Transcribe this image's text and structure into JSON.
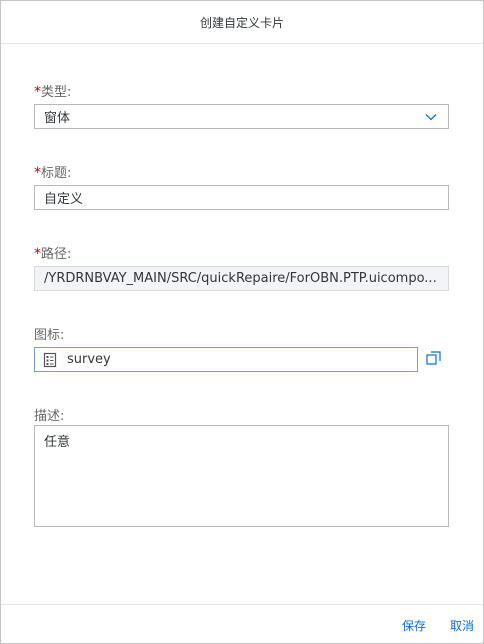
{
  "dialog": {
    "title": "创建自定义卡片"
  },
  "form": {
    "type": {
      "required": "*",
      "label": "类型:",
      "value": "窗体"
    },
    "title": {
      "required": "*",
      "label": "标题:",
      "value": "自定义"
    },
    "path": {
      "required": "*",
      "label": "路径:",
      "value": "/YRDRNBVAY_MAIN/SRC/quickRepaire/ForOBN.PTP.uicompo..."
    },
    "icon": {
      "label": "图标:",
      "value": "survey",
      "icon_name": "survey-icon"
    },
    "description": {
      "label": "描述:",
      "value": "任意"
    }
  },
  "footer": {
    "save_label": "保存",
    "cancel_label": "取消"
  },
  "colors": {
    "accent": "#0a6ed1",
    "required": "#bb0000"
  }
}
